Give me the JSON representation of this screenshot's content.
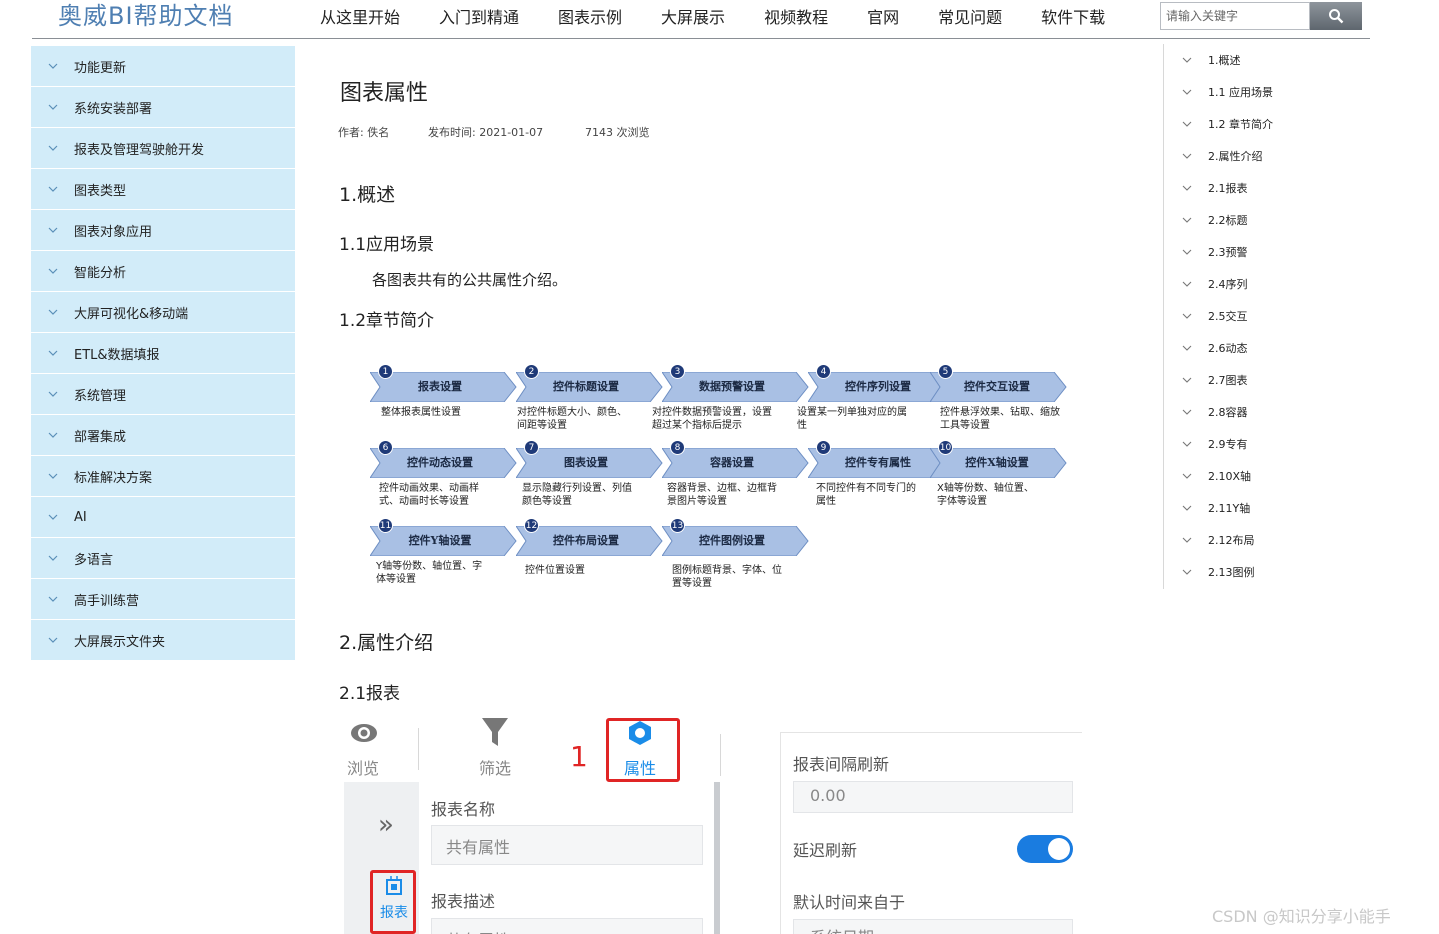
{
  "header": {
    "logo": "奥威BI帮助文档",
    "nav": [
      "从这里开始",
      "入门到精通",
      "图表示例",
      "大屏展示",
      "视频教程",
      "官网",
      "常见问题",
      "软件下载"
    ],
    "search_placeholder": "请输入关键字"
  },
  "sidebar": {
    "items": [
      "功能更新",
      "系统安装部署",
      "报表及管理驾驶舱开发",
      "图表类型",
      "图表对象应用",
      "智能分析",
      "大屏可视化&移动端",
      "ETL&数据填报",
      "系统管理",
      "部署集成",
      "标准解决方案",
      "AI",
      "多语言",
      "高手训练营",
      "大屏展示文件夹"
    ]
  },
  "article": {
    "title": "图表属性",
    "author": "作者: 佚名",
    "published": "发布时间: 2021-01-07",
    "views": "7143 次浏览",
    "h_overview": "1.概述",
    "h_scene": "1.1应用场景",
    "scene_text": "各图表共有的公共属性介绍。",
    "h_chapters": "1.2章节简介",
    "h_props": "2.属性介绍",
    "h_report": "2.1报表"
  },
  "diagram": {
    "steps": [
      {
        "num": "1",
        "label": "报表设置",
        "desc": "整体报表属性设置"
      },
      {
        "num": "2",
        "label": "控件标题设置",
        "desc": "对控件标题大小、颜色、间距等设置"
      },
      {
        "num": "3",
        "label": "数据预警设置",
        "desc": "对控件数据预警设置，设置超过某个指标后提示"
      },
      {
        "num": "4",
        "label": "控件序列设置",
        "desc": "设置某一列单独对应的属性"
      },
      {
        "num": "5",
        "label": "控件交互设置",
        "desc": "控件悬浮效果、钻取、缩放工具等设置"
      },
      {
        "num": "6",
        "label": "控件动态设置",
        "desc": "控件动画效果、动画样式、动画时长等设置"
      },
      {
        "num": "7",
        "label": "图表设置",
        "desc": "显示隐藏行列设置、列值颜色等设置"
      },
      {
        "num": "8",
        "label": "容器设置",
        "desc": "容器背景、边框、边框背景图片等设置"
      },
      {
        "num": "9",
        "label": "控件专有属性",
        "desc": "不同控件有不同专门的属性"
      },
      {
        "num": "10",
        "label": "控件X轴设置",
        "desc": "X轴等份数、轴位置、字体等设置"
      },
      {
        "num": "11",
        "label": "控件Y轴设置",
        "desc": "Y轴等份数、轴位置、字体等设置"
      },
      {
        "num": "12",
        "label": "控件布局设置",
        "desc": "控件位置设置"
      },
      {
        "num": "13",
        "label": "控件图例设置",
        "desc": "图例标题背景、字体、位置等设置"
      }
    ]
  },
  "toc": {
    "items": [
      "1.概述",
      "1.1 应用场景",
      "1.2 章节简介",
      "2.属性介绍",
      "2.1报表",
      "2.2标题",
      "2.3预警",
      "2.4序列",
      "2.5交互",
      "2.6动态",
      "2.7图表",
      "2.8容器",
      "2.9专有",
      "2.10X轴",
      "2.11Y轴",
      "2.12布局",
      "2.13图例"
    ]
  },
  "screenshot": {
    "tab_browse": "浏览",
    "tab_filter": "筛选",
    "tab_props": "属性",
    "step_number": "1",
    "rail_report": "报表",
    "report_name_label": "报表名称",
    "report_name_value": "共有属性",
    "report_desc_label": "报表描述",
    "report_desc_value": "共有属性",
    "refresh_label": "报表间隔刷新",
    "refresh_value": "0.00",
    "delay_label": "延迟刷新",
    "default_time_label": "默认时间来自于",
    "default_time_value": "系统日期"
  },
  "watermark": "CSDN @知识分享小能手"
}
